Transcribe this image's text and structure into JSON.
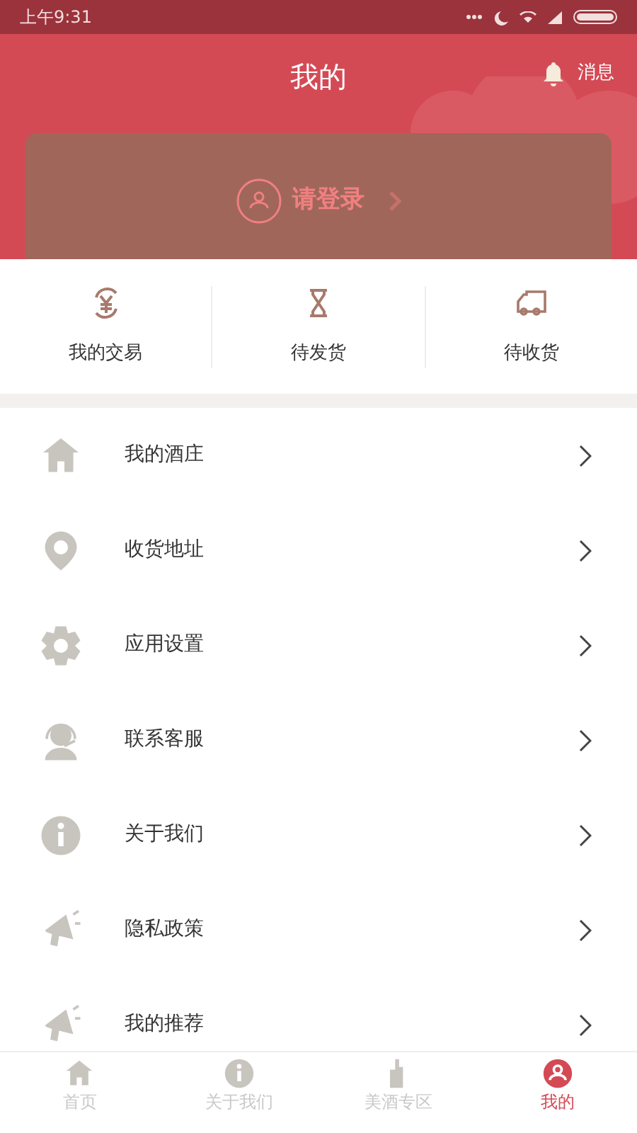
{
  "status_bar": {
    "time": "上午9:31"
  },
  "header": {
    "title": "我的",
    "message_label": "消息"
  },
  "login": {
    "label": "请登录"
  },
  "quick_actions": [
    {
      "kind": "yen",
      "label": "我的交易"
    },
    {
      "kind": "hourglass",
      "label": "待发货"
    },
    {
      "kind": "truck",
      "label": "待收货"
    }
  ],
  "menu": [
    {
      "kind": "house",
      "label": "我的酒庄"
    },
    {
      "kind": "pin",
      "label": "收货地址"
    },
    {
      "kind": "gear",
      "label": "应用设置"
    },
    {
      "kind": "headset",
      "label": "联系客服"
    },
    {
      "kind": "info",
      "label": "关于我们"
    },
    {
      "kind": "megaphone",
      "label": "隐私政策"
    },
    {
      "kind": "megaphone",
      "label": "我的推荐"
    }
  ],
  "tabs": [
    {
      "kind": "house",
      "label": "首页",
      "selected": false
    },
    {
      "kind": "info",
      "label": "关于我们",
      "selected": false
    },
    {
      "kind": "bottle",
      "label": "美酒专区",
      "selected": false
    },
    {
      "kind": "user",
      "label": "我的",
      "selected": true
    }
  ]
}
